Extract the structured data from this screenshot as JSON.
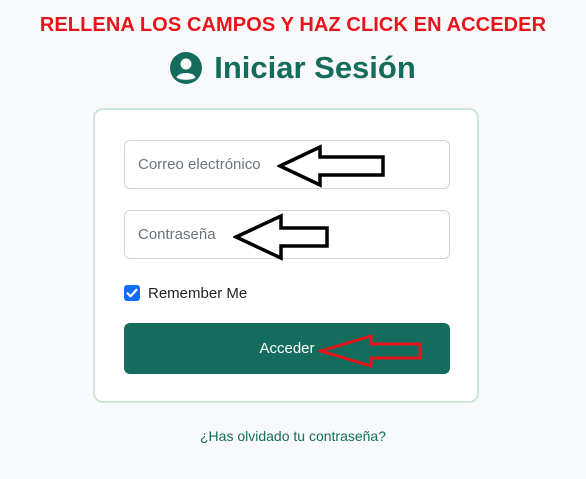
{
  "instruction": "RELLENA LOS CAMPOS Y HAZ CLICK EN ACCEDER",
  "header": {
    "title": "Iniciar Sesión",
    "icon": "user-circle-icon"
  },
  "form": {
    "email_placeholder": "Correo electrónico",
    "password_placeholder": "Contraseña",
    "remember_label": "Remember Me",
    "remember_checked": true,
    "submit_label": "Acceder"
  },
  "forgot_link": "¿Has olvidado tu contraseña?",
  "annotations": {
    "email_arrow": "left-arrow-icon",
    "password_arrow": "left-arrow-icon",
    "submit_arrow": "left-arrow-icon",
    "submit_arrow_color": "#e8141b"
  },
  "colors": {
    "primary": "#146c5c",
    "instruction": "#e8141b",
    "checkbox": "#0d6efd",
    "background": "#f8f9fa",
    "card_border": "#cde7d6"
  }
}
